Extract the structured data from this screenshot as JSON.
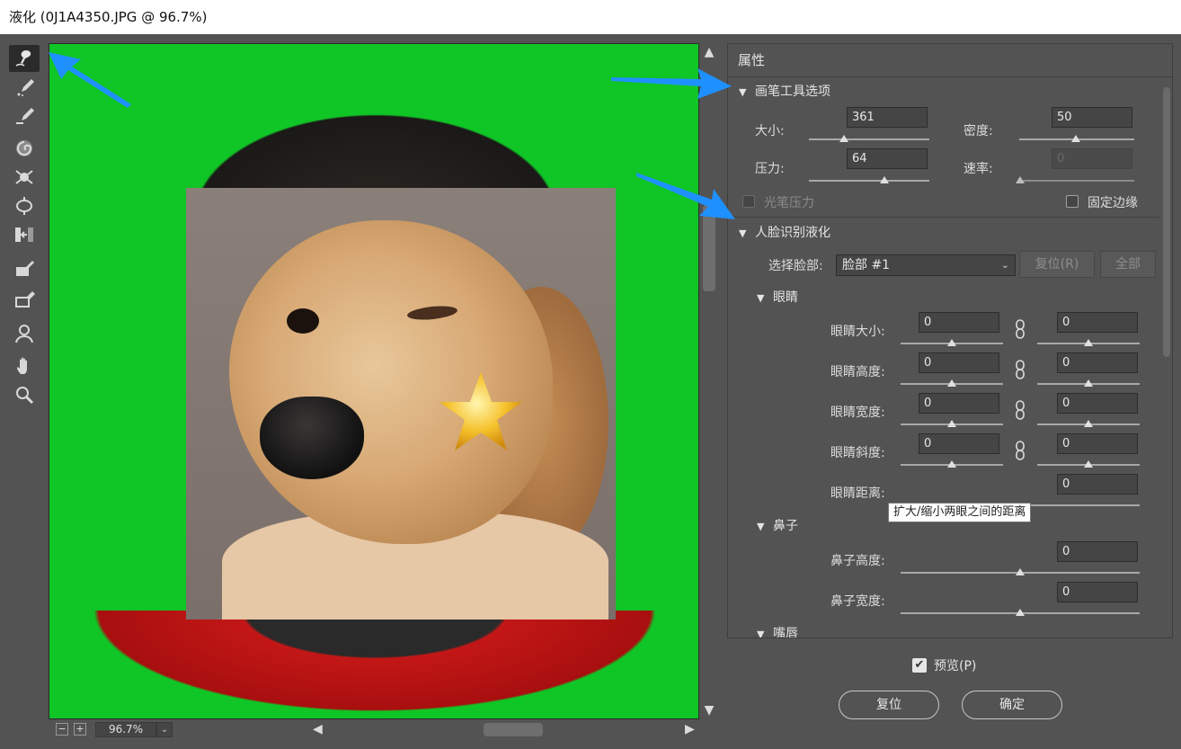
{
  "window": {
    "title": "液化 (0J1A4350.JPG @ 96.7%)"
  },
  "tools": [
    {
      "name": "forward-warp-tool-icon",
      "active": true
    },
    {
      "name": "reconstruct-tool-icon"
    },
    {
      "name": "smooth-tool-icon"
    },
    {
      "name": "twirl-tool-icon"
    },
    {
      "name": "pucker-tool-icon"
    },
    {
      "name": "bloat-tool-icon"
    },
    {
      "name": "push-left-tool-icon"
    },
    {
      "name": "freeze-mask-tool-icon"
    },
    {
      "name": "thaw-mask-tool-icon"
    },
    {
      "name": "face-tool-icon"
    },
    {
      "name": "hand-tool-icon"
    },
    {
      "name": "zoom-tool-icon"
    }
  ],
  "canvas": {
    "zoom": "96.7%",
    "zoom_out": "−",
    "zoom_in": "+"
  },
  "panel": {
    "title": "属性",
    "brush_section": {
      "label": "画笔工具选项",
      "size_label": "大小:",
      "size_value": "361",
      "density_label": "密度:",
      "density_value": "50",
      "pressure_label": "压力:",
      "pressure_value": "64",
      "rate_label": "速率:",
      "rate_value": "0",
      "stylus_label": "光笔压力",
      "pin_edges_label": "固定边缘"
    },
    "face_section": {
      "label": "人脸识别液化",
      "select_face_label": "选择脸部:",
      "select_face_value": "脸部 #1",
      "reset_label": "复位(R)",
      "all_label": "全部",
      "eyes": {
        "label": "眼睛",
        "size_label": "眼睛大小:",
        "height_label": "眼睛高度:",
        "width_label": "眼睛宽度:",
        "tilt_label": "眼睛斜度:",
        "distance_label": "眼睛距离:",
        "size_left": "0",
        "size_right": "0",
        "height_left": "0",
        "height_right": "0",
        "width_left": "0",
        "width_right": "0",
        "tilt_left": "0",
        "tilt_right": "0",
        "distance": "0",
        "tooltip": "扩大/缩小两眼之间的距离"
      },
      "nose": {
        "label": "鼻子",
        "height_label": "鼻子高度:",
        "height_value": "0",
        "width_label": "鼻子宽度:",
        "width_value": "0"
      },
      "mouth": {
        "label": "嘴唇"
      }
    }
  },
  "footer": {
    "preview_label": "预览(P)",
    "preview_checked": true,
    "reset_button": "复位",
    "ok_button": "确定"
  },
  "colors": {
    "background": "#535353",
    "green_screen": "#10c526",
    "annotation_arrow": "#1e90ff"
  }
}
